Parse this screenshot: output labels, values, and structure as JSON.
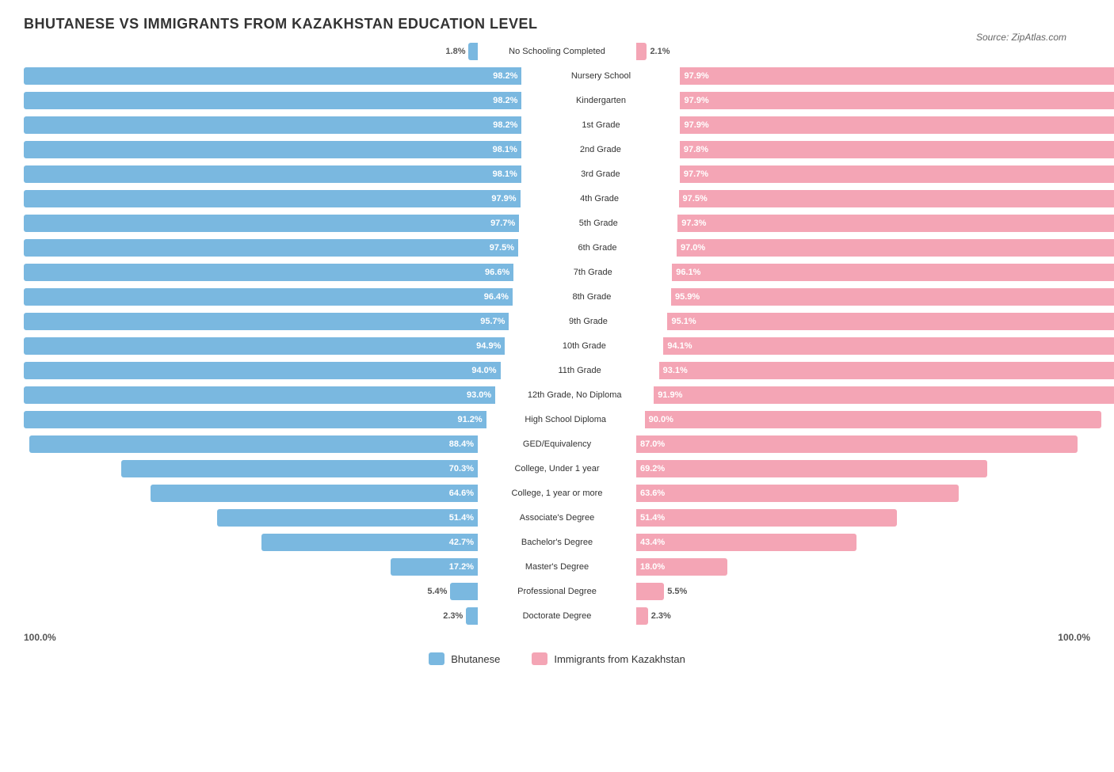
{
  "title": "BHUTANESE VS IMMIGRANTS FROM KAZAKHSTAN EDUCATION LEVEL",
  "source": "Source: ZipAtlas.com",
  "colors": {
    "blue": "#7ab8e0",
    "pink": "#f4a5b5"
  },
  "legend": {
    "blue_label": "Bhutanese",
    "pink_label": "Immigrants from Kazakhstan"
  },
  "max_width": 640,
  "rows": [
    {
      "label": "No Schooling Completed",
      "left_val": 1.8,
      "right_val": 2.1,
      "left_pct": 1.8,
      "right_pct": 2.1
    },
    {
      "label": "Nursery School",
      "left_val": 98.2,
      "right_val": 97.9,
      "left_pct": 98.2,
      "right_pct": 97.9
    },
    {
      "label": "Kindergarten",
      "left_val": 98.2,
      "right_val": 97.9,
      "left_pct": 98.2,
      "right_pct": 97.9
    },
    {
      "label": "1st Grade",
      "left_val": 98.2,
      "right_val": 97.9,
      "left_pct": 98.2,
      "right_pct": 97.9
    },
    {
      "label": "2nd Grade",
      "left_val": 98.1,
      "right_val": 97.8,
      "left_pct": 98.1,
      "right_pct": 97.8
    },
    {
      "label": "3rd Grade",
      "left_val": 98.1,
      "right_val": 97.7,
      "left_pct": 98.1,
      "right_pct": 97.7
    },
    {
      "label": "4th Grade",
      "left_val": 97.9,
      "right_val": 97.5,
      "left_pct": 97.9,
      "right_pct": 97.5
    },
    {
      "label": "5th Grade",
      "left_val": 97.7,
      "right_val": 97.3,
      "left_pct": 97.7,
      "right_pct": 97.3
    },
    {
      "label": "6th Grade",
      "left_val": 97.5,
      "right_val": 97.0,
      "left_pct": 97.5,
      "right_pct": 97.0
    },
    {
      "label": "7th Grade",
      "left_val": 96.6,
      "right_val": 96.1,
      "left_pct": 96.6,
      "right_pct": 96.1
    },
    {
      "label": "8th Grade",
      "left_val": 96.4,
      "right_val": 95.9,
      "left_pct": 96.4,
      "right_pct": 95.9
    },
    {
      "label": "9th Grade",
      "left_val": 95.7,
      "right_val": 95.1,
      "left_pct": 95.7,
      "right_pct": 95.1
    },
    {
      "label": "10th Grade",
      "left_val": 94.9,
      "right_val": 94.1,
      "left_pct": 94.9,
      "right_pct": 94.1
    },
    {
      "label": "11th Grade",
      "left_val": 94.0,
      "right_val": 93.1,
      "left_pct": 94.0,
      "right_pct": 93.1
    },
    {
      "label": "12th Grade, No Diploma",
      "left_val": 93.0,
      "right_val": 91.9,
      "left_pct": 93.0,
      "right_pct": 91.9
    },
    {
      "label": "High School Diploma",
      "left_val": 91.2,
      "right_val": 90.0,
      "left_pct": 91.2,
      "right_pct": 90.0
    },
    {
      "label": "GED/Equivalency",
      "left_val": 88.4,
      "right_val": 87.0,
      "left_pct": 88.4,
      "right_pct": 87.0
    },
    {
      "label": "College, Under 1 year",
      "left_val": 70.3,
      "right_val": 69.2,
      "left_pct": 70.3,
      "right_pct": 69.2
    },
    {
      "label": "College, 1 year or more",
      "left_val": 64.6,
      "right_val": 63.6,
      "left_pct": 64.6,
      "right_pct": 63.6
    },
    {
      "label": "Associate's Degree",
      "left_val": 51.4,
      "right_val": 51.4,
      "left_pct": 51.4,
      "right_pct": 51.4
    },
    {
      "label": "Bachelor's Degree",
      "left_val": 42.7,
      "right_val": 43.4,
      "left_pct": 42.7,
      "right_pct": 43.4
    },
    {
      "label": "Master's Degree",
      "left_val": 17.2,
      "right_val": 18.0,
      "left_pct": 17.2,
      "right_pct": 18.0
    },
    {
      "label": "Professional Degree",
      "left_val": 5.4,
      "right_val": 5.5,
      "left_pct": 5.4,
      "right_pct": 5.5
    },
    {
      "label": "Doctorate Degree",
      "left_val": 2.3,
      "right_val": 2.3,
      "left_pct": 2.3,
      "right_pct": 2.3
    }
  ],
  "footer": {
    "left": "100.0%",
    "right": "100.0%"
  }
}
